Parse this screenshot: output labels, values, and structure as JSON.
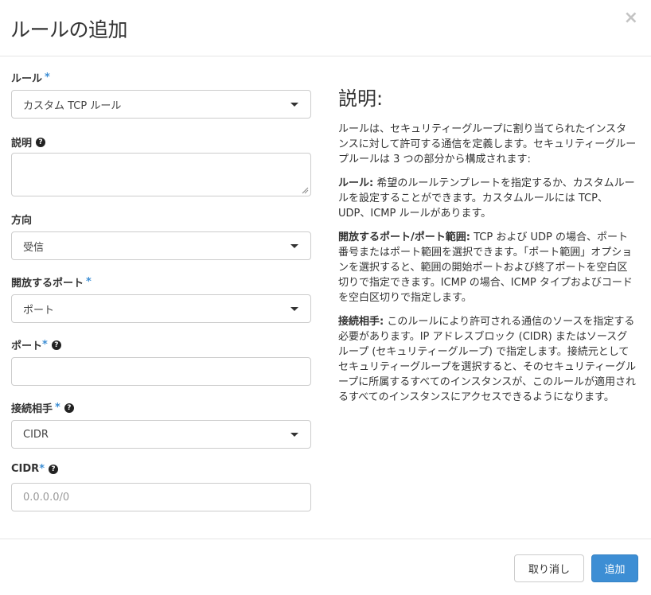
{
  "header": {
    "title": "ルールの追加",
    "close_glyph": "×"
  },
  "form": {
    "rule": {
      "label": "ルール",
      "required_mark": "*",
      "selected": "カスタム TCP ルール"
    },
    "description": {
      "label": "説明",
      "help_glyph": "?",
      "value": ""
    },
    "direction": {
      "label": "方向",
      "selected": "受信"
    },
    "open_port": {
      "label": "開放するポート",
      "required_mark": "*",
      "selected": "ポート"
    },
    "port": {
      "label": "ポート",
      "required_mark": "*",
      "help_glyph": "?",
      "value": ""
    },
    "remote": {
      "label": "接続相手",
      "required_mark": "*",
      "help_glyph": "?",
      "selected": "CIDR"
    },
    "cidr": {
      "label": "CIDR",
      "required_mark": "*",
      "help_glyph": "?",
      "placeholder": "0.0.0.0/0"
    }
  },
  "help": {
    "title": "説明:",
    "intro": "ルールは、セキュリティーグループに割り当てられたインスタンスに対して許可する通信を定義します。セキュリティーグループルールは 3 つの部分から構成されます:",
    "rule_term": "ルール:",
    "rule_text": " 希望のルールテンプレートを指定するか、カスタムルールを設定することができます。カスタムルールには TCP、UDP、ICMP ルールがあります。",
    "port_term": "開放するポート/ポート範囲:",
    "port_text": " TCP および UDP の場合、ポート番号またはポート範囲を選択できます。「ポート範囲」オプションを選択すると、範囲の開始ポートおよび終了ポートを空白区切りで指定できます。ICMP の場合、ICMP タイプおよびコードを空白区切りで指定します。",
    "remote_term": "接続相手:",
    "remote_text": " このルールにより許可される通信のソースを指定する必要があります。IP アドレスブロック (CIDR) またはソースグループ (セキュリティーグループ) で指定します。接続元としてセキュリティーグループを選択すると、そのセキュリティーグループに所属するすべてのインスタンスが、このルールが適用されるすべてのインスタンスにアクセスできるようになります。"
  },
  "footer": {
    "cancel_label": "取り消し",
    "add_label": "追加"
  },
  "colors": {
    "accent": "#3d8ed4",
    "border": "#cccccc",
    "text": "#333333"
  }
}
